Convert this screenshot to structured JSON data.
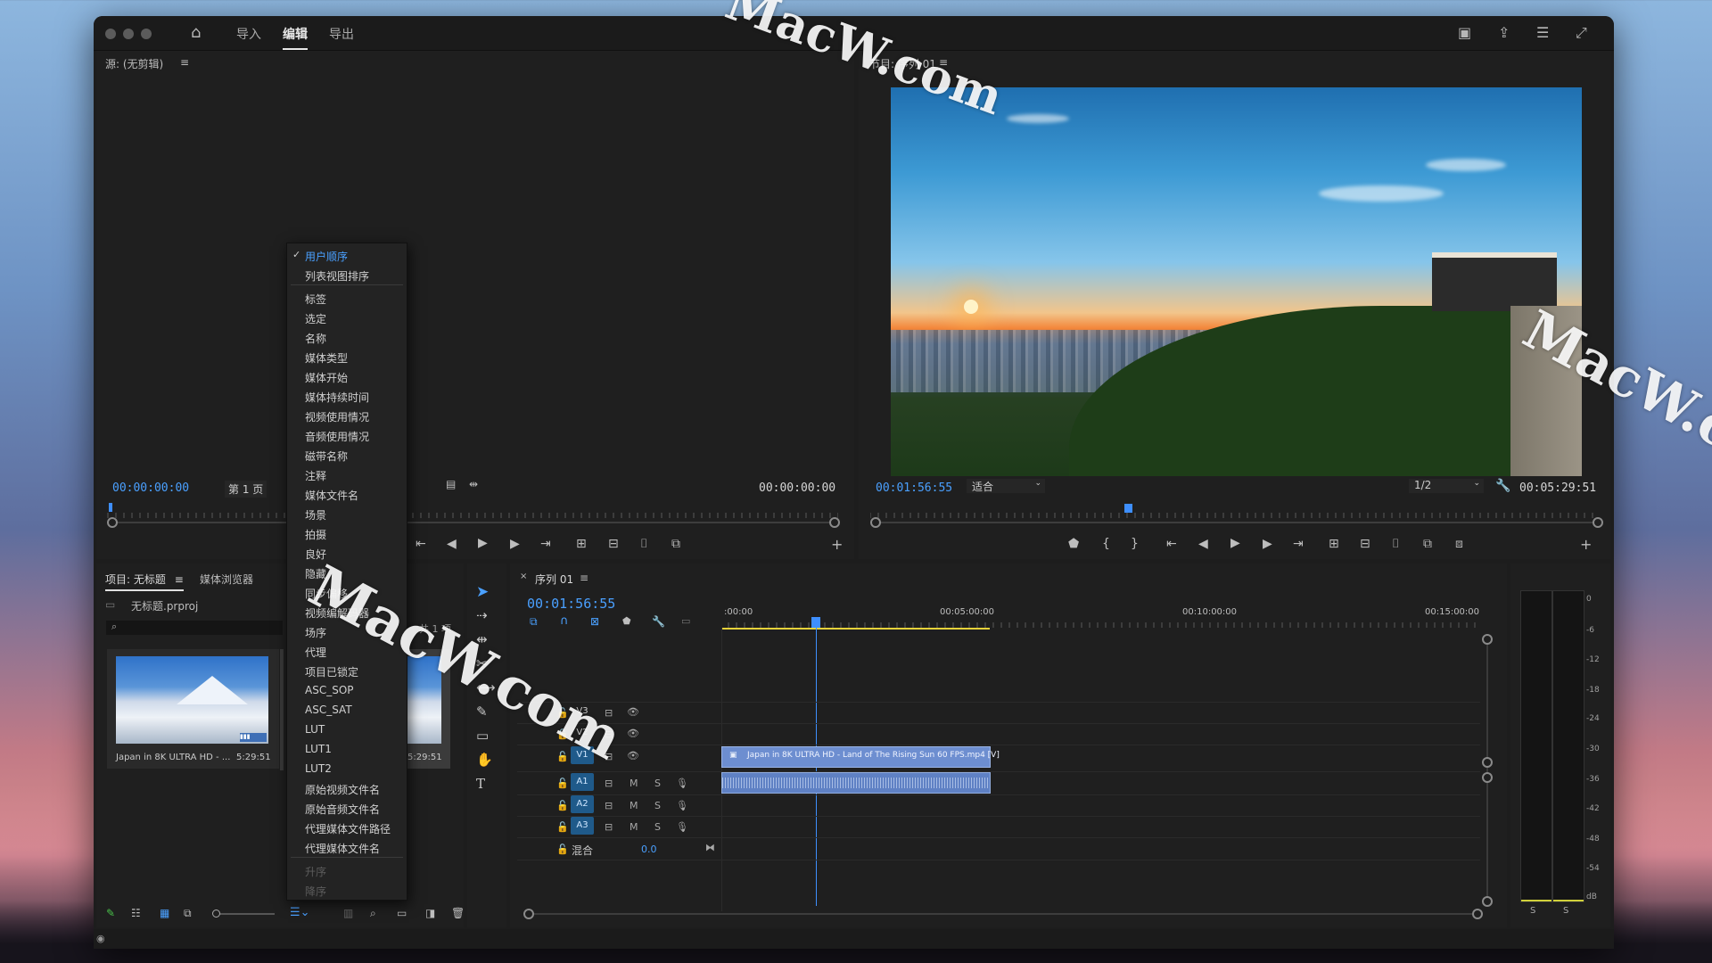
{
  "app": {
    "nav": [
      "导入",
      "编辑",
      "导出"
    ],
    "active_nav": "编辑"
  },
  "source_panel": {
    "title": "源: (无剪辑)",
    "timecode_left": "00:00:00:00",
    "page": "第 1 页",
    "timecode_right": "00:00:00:00"
  },
  "program_panel": {
    "title": "节目: 序列 01",
    "timecode": "00:01:56:55",
    "fit": "适合",
    "resolution": "1/2",
    "duration": "00:05:29:51"
  },
  "sort_menu": {
    "top_items": [
      "用户顺序",
      "列表视图排序"
    ],
    "checked": "用户顺序",
    "fields": [
      "标签",
      "选定",
      "名称",
      "媒体类型",
      "媒体开始",
      "媒体持续时间",
      "视频使用情况",
      "音频使用情况",
      "磁带名称",
      "注释",
      "媒体文件名",
      "场景",
      "拍摄",
      "良好",
      "隐藏",
      "同步偏移",
      "视频编解码器",
      "场序",
      "代理",
      "项目已锁定",
      "ASC_SOP",
      "ASC_SAT",
      "LUT",
      "LUT1",
      "LUT2",
      "原始视频文件名",
      "原始音频文件名",
      "代理媒体文件路径",
      "代理媒体文件名"
    ],
    "order_items": [
      "升序",
      "降序"
    ]
  },
  "project_panel": {
    "tabs": [
      "项目: 无标题",
      "媒体浏览器"
    ],
    "file": "无标题.prproj",
    "item_name": "Japan in 8K ULTRA HD - ...",
    "item_duration": "5:29:51",
    "item2_duration": "5:29:51",
    "item_count": "共 1 项"
  },
  "timeline": {
    "tab": "序列 01",
    "timecode": "00:01:56:55",
    "ruler": [
      ":00:00",
      "00:05:00:00",
      "00:10:00:00",
      "00:15:00:00"
    ],
    "video_tracks": [
      "V3",
      "V2",
      "V1"
    ],
    "audio_tracks": [
      "A1",
      "A2",
      "A3"
    ],
    "mix_label": "混合",
    "mix_value": "0.0",
    "clip_name": "Japan in 8K ULTRA HD - Land of The Rising Sun 60 FPS.mp4 [V]",
    "track_m": "M",
    "track_s": "S"
  },
  "audio_meter": {
    "scale": [
      "0",
      "-6",
      "-12",
      "-18",
      "-24",
      "-30",
      "-36",
      "-42",
      "-48",
      "-54",
      "dB"
    ],
    "solo_labels": [
      "S",
      "S"
    ]
  },
  "watermark": "MacW.com",
  "colors": {
    "accent_blue": "#4aa0ff",
    "panel_bg": "#1f1f1f",
    "window_bg": "#1d1d1d"
  }
}
